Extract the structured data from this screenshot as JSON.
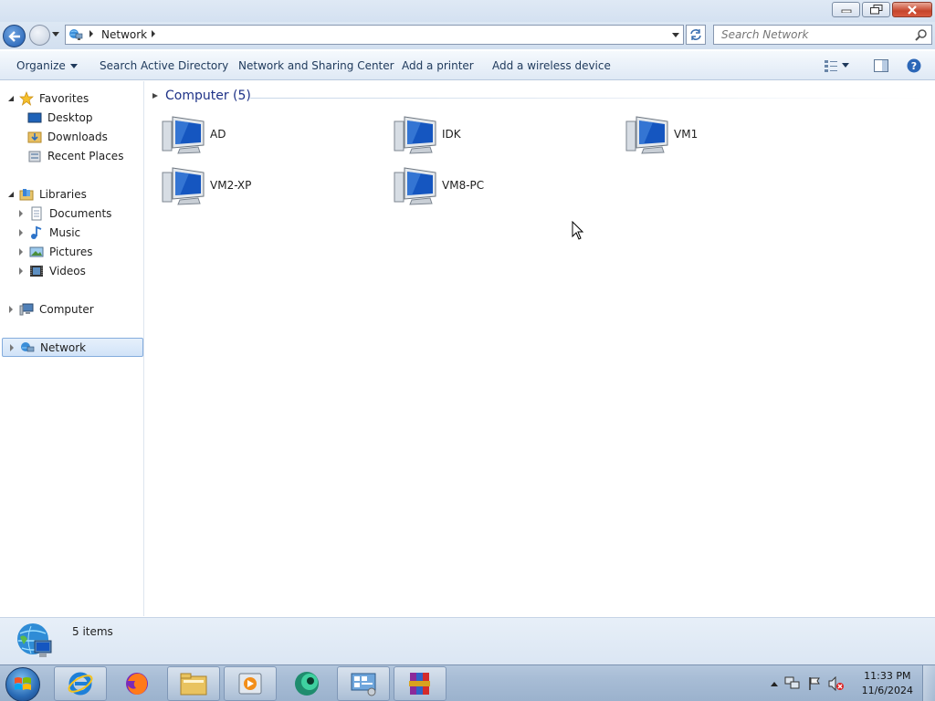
{
  "window": {
    "controls": [
      "minimize",
      "restore",
      "close"
    ]
  },
  "address": {
    "location": "Network",
    "search_placeholder": "Search Network"
  },
  "toolbar": {
    "organize": "Organize",
    "search_ad": "Search Active Directory",
    "network_sharing": "Network and Sharing Center",
    "add_printer": "Add a printer",
    "add_wireless": "Add a wireless device"
  },
  "nav": {
    "favorites": "Favorites",
    "desktop": "Desktop",
    "downloads": "Downloads",
    "recent_places": "Recent Places",
    "libraries": "Libraries",
    "documents": "Documents",
    "music": "Music",
    "pictures": "Pictures",
    "videos": "Videos",
    "computer": "Computer",
    "network": "Network"
  },
  "content": {
    "group_header": "Computer (5)",
    "computers": [
      "AD",
      "IDK",
      "VM1",
      "VM2-XP",
      "VM8-PC"
    ]
  },
  "status": {
    "item_count": "5 items"
  },
  "taskbar": {
    "pinned": [
      "internet-explorer",
      "firefox",
      "windows-explorer",
      "media-player",
      "app-green-circle",
      "control-panel",
      "winrar"
    ],
    "time": "11:33 PM",
    "date": "11/6/2024"
  },
  "colors": {
    "group_header": "#1e3287",
    "toolbar_text": "#1e395b",
    "selection": "#d1e3f8"
  }
}
